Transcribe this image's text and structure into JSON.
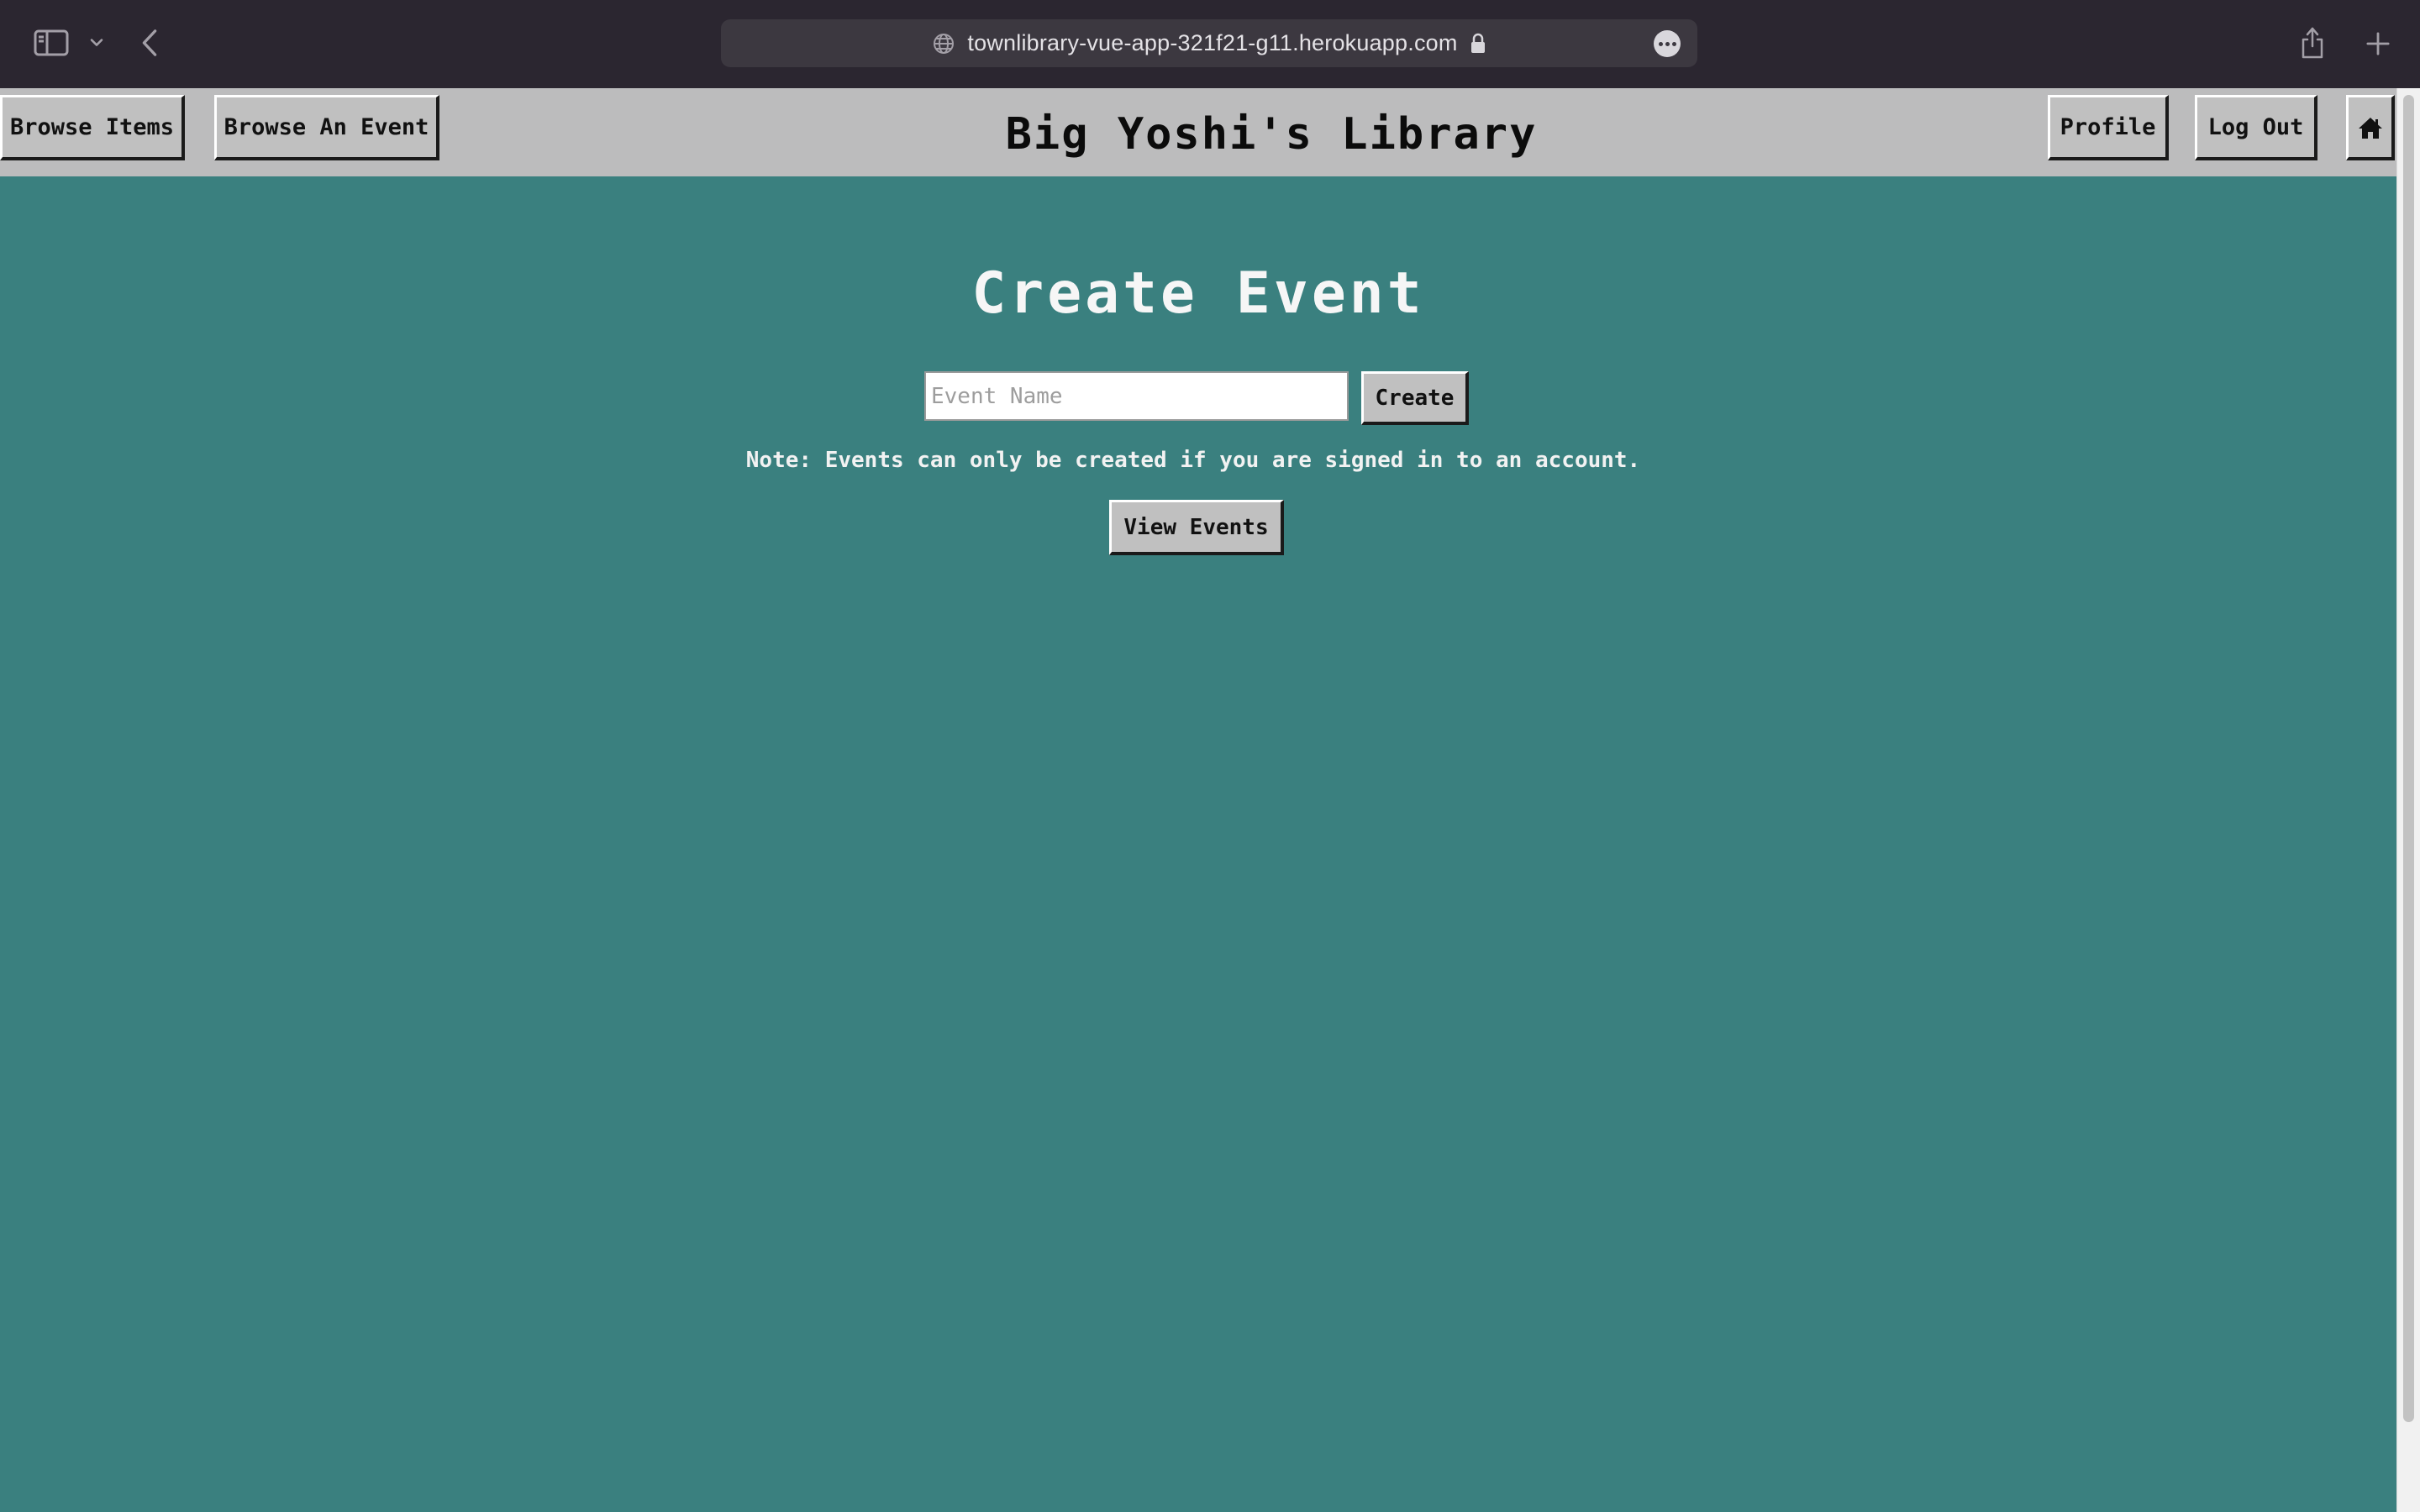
{
  "browser": {
    "url": "townlibrary-vue-app-321f21-g11.herokuapp.com",
    "icons": {
      "sidebar": "sidebar-icon",
      "chevron": "chevron-down-icon",
      "back": "back-arrow-icon",
      "site": "globe-icon",
      "secure": "lock-icon",
      "more": "more-icon",
      "share": "share-icon",
      "new_tab": "plus-icon"
    }
  },
  "header": {
    "title": "Big Yoshi's Library",
    "nav_left": [
      "Browse Items",
      "Browse An Event"
    ],
    "nav_right": [
      "Profile",
      "Log Out"
    ],
    "home_icon": "home-icon"
  },
  "main": {
    "heading": "Create Event",
    "input_placeholder": "Event Name",
    "input_value": "",
    "create_label": "Create",
    "note": "Note: Events can only be created if you are signed in to an account.",
    "view_events_label": "View Events"
  },
  "colors": {
    "page_background": "#3a807f",
    "header_background": "#bcbcbd",
    "button_face": "#c0c0c0",
    "browser_chrome": "#2b2630"
  }
}
